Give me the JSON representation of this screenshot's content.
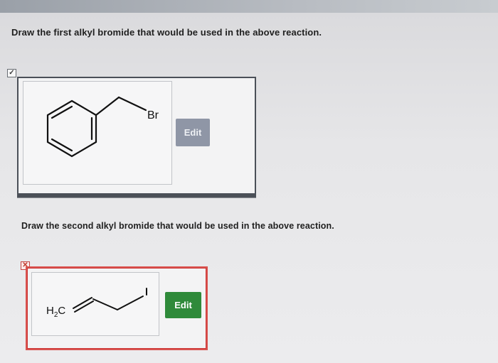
{
  "questions": {
    "first": "Draw the first alkyl bromide that would be used in the above reaction.",
    "second": "Draw the second alkyl bromide that would be used in the above reaction."
  },
  "answer1": {
    "status": "correct",
    "status_glyph": "✓",
    "atom_label": "Br",
    "edit_label": "Edit"
  },
  "answer2": {
    "status": "incorrect",
    "status_glyph": "✕",
    "atom_label_main": "H",
    "atom_label_sub": "2",
    "atom_label_tail": "C",
    "edit_label": "Edit"
  },
  "colors": {
    "incorrect_border": "#d9534f",
    "edit_green": "#2f8a3a",
    "edit_disabled": "#8f96a6"
  }
}
